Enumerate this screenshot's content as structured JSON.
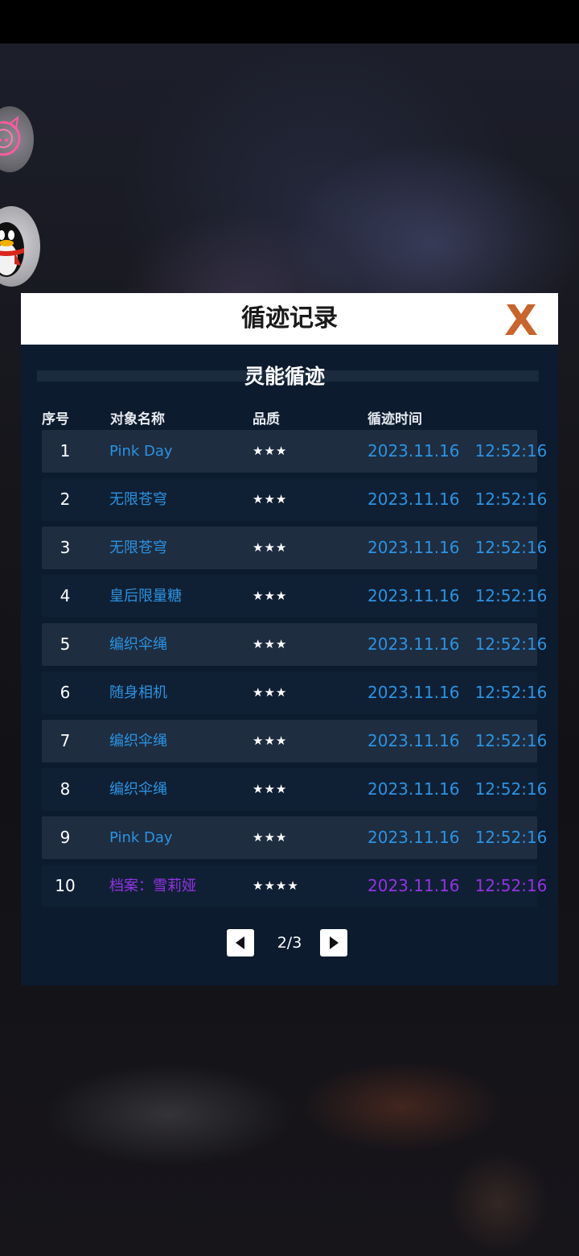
{
  "dialog": {
    "title": "循迹记录",
    "section_title": "灵能循迹"
  },
  "columns": {
    "index": "序号",
    "name": "对象名称",
    "quality": "品质",
    "time": "循迹时间"
  },
  "records": [
    {
      "index": "1",
      "name": "Pink Day",
      "quality": "★★★",
      "time": "2023.11.16   12:52:16",
      "color": "#2b93e2"
    },
    {
      "index": "2",
      "name": "无限苍穹",
      "quality": "★★★",
      "time": "2023.11.16   12:52:16",
      "color": "#2b93e2"
    },
    {
      "index": "3",
      "name": "无限苍穹",
      "quality": "★★★",
      "time": "2023.11.16   12:52:16",
      "color": "#2b93e2"
    },
    {
      "index": "4",
      "name": "皇后限量糖",
      "quality": "★★★",
      "time": "2023.11.16   12:52:16",
      "color": "#2b93e2"
    },
    {
      "index": "5",
      "name": "编织伞绳",
      "quality": "★★★",
      "time": "2023.11.16   12:52:16",
      "color": "#2b93e2"
    },
    {
      "index": "6",
      "name": "随身相机",
      "quality": "★★★",
      "time": "2023.11.16   12:52:16",
      "color": "#2b93e2"
    },
    {
      "index": "7",
      "name": "编织伞绳",
      "quality": "★★★",
      "time": "2023.11.16   12:52:16",
      "color": "#2b93e2"
    },
    {
      "index": "8",
      "name": "编织伞绳",
      "quality": "★★★",
      "time": "2023.11.16   12:52:16",
      "color": "#2b93e2"
    },
    {
      "index": "9",
      "name": "Pink Day",
      "quality": "★★★",
      "time": "2023.11.16   12:52:16",
      "color": "#2b93e2"
    },
    {
      "index": "10",
      "name": "档案：雪莉娅",
      "quality": "★★★★",
      "time": "2023.11.16   12:52:16",
      "color": "#9233e6"
    }
  ],
  "pager": {
    "page": "2/3"
  },
  "icons": {
    "close": "close-icon",
    "prev": "triangle-left-icon",
    "next": "triangle-right-icon"
  },
  "colors": {
    "accent_close": "#c8642c",
    "name_blue": "#2b93e2",
    "name_purple": "#9233e6",
    "dialog_bg": "#0c1b2e"
  }
}
